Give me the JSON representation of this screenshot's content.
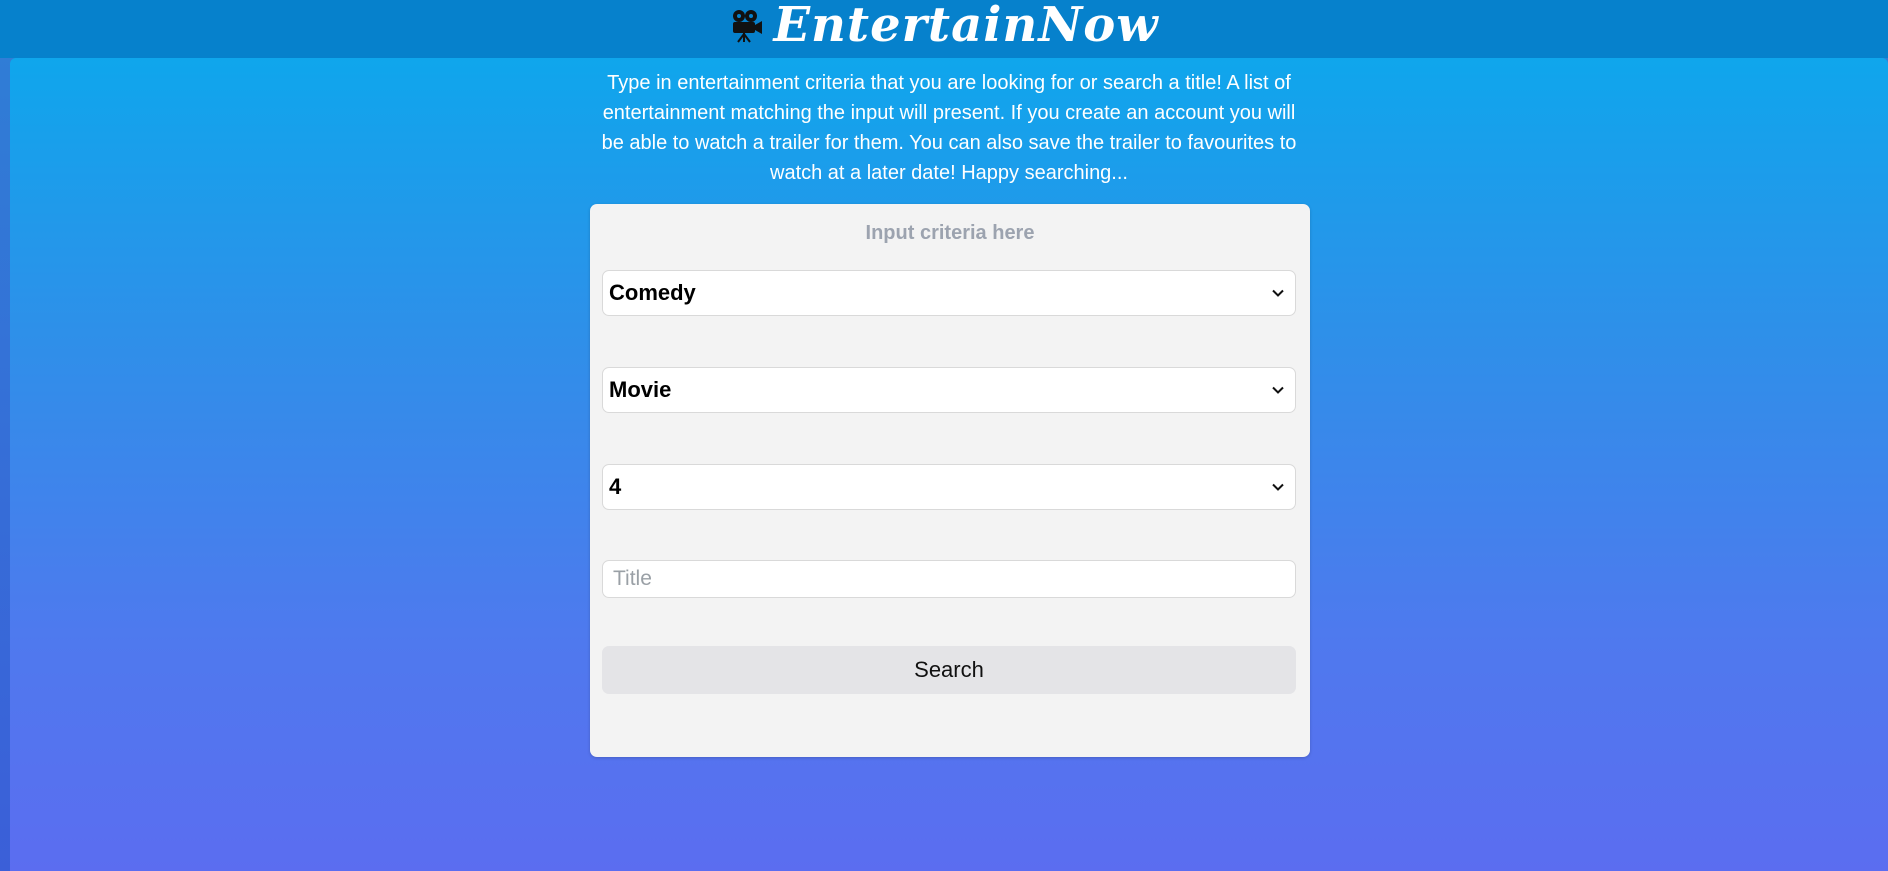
{
  "header": {
    "title": "EntertainNow",
    "logo_icon": "movie-camera-icon"
  },
  "intro": {
    "text": "Type in entertainment criteria that you are looking for or search a title! A list of entertainment matching the input will present. If you create an account you will be able to watch a trailer for them. You can also save the trailer to favourites to watch at a later date! Happy searching..."
  },
  "form": {
    "heading": "Input criteria here",
    "genre": {
      "selected": "Comedy",
      "icon": "chevron-down-icon"
    },
    "type": {
      "selected": "Movie",
      "icon": "chevron-down-icon"
    },
    "rating": {
      "selected": "4",
      "icon": "chevron-down-icon"
    },
    "title": {
      "value": "",
      "placeholder": "Title"
    },
    "search_label": "Search"
  },
  "colors": {
    "header_bg": "#0681cc",
    "gradient_top": "#0fa6ec",
    "gradient_bottom": "#5b6df0",
    "panel_bg": "#f3f3f3",
    "button_bg": "#e4e4e7",
    "heading_text": "#9ca3af"
  }
}
